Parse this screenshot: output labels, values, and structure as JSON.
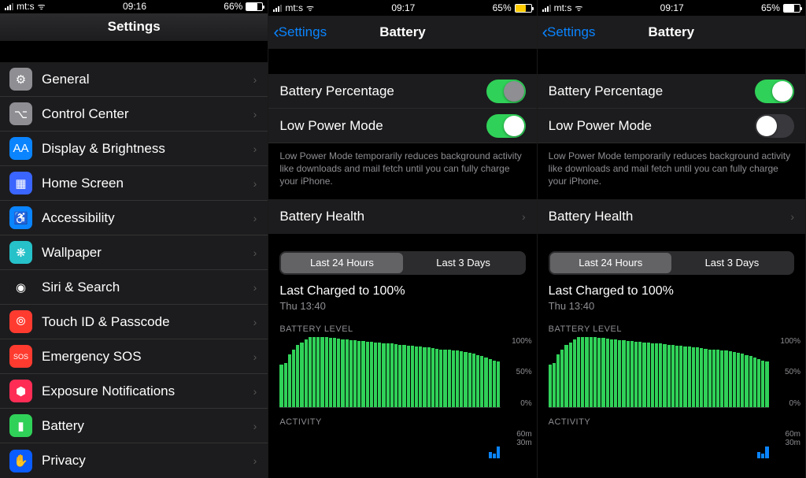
{
  "screens": [
    {
      "time": "09:16",
      "carrier": "mt:s",
      "battery_pct": "66%",
      "battery_fill": 66,
      "battery_color": "white",
      "title": "Settings",
      "has_back": false
    },
    {
      "time": "09:17",
      "carrier": "mt:s",
      "battery_pct": "65%",
      "battery_fill": 65,
      "battery_color": "yellow",
      "title": "Battery",
      "back_label": "Settings",
      "toggles": {
        "battery_percentage_on": true,
        "low_power_on": true,
        "dimmed_knob": true
      }
    },
    {
      "time": "09:17",
      "carrier": "mt:s",
      "battery_pct": "65%",
      "battery_fill": 65,
      "battery_color": "white",
      "title": "Battery",
      "back_label": "Settings",
      "toggles": {
        "battery_percentage_on": true,
        "low_power_on": false,
        "dimmed_knob": false
      }
    }
  ],
  "settings_items": [
    {
      "label": "General",
      "icon": "⚙",
      "bg": "#8e8e93"
    },
    {
      "label": "Control Center",
      "icon": "⌥",
      "bg": "#8e8e93"
    },
    {
      "label": "Display & Brightness",
      "icon": "AA",
      "bg": "#0a84ff"
    },
    {
      "label": "Home Screen",
      "icon": "▦",
      "bg": "#3a65ff"
    },
    {
      "label": "Accessibility",
      "icon": "♿",
      "bg": "#0a84ff"
    },
    {
      "label": "Wallpaper",
      "icon": "❋",
      "bg": "#26c1c9"
    },
    {
      "label": "Siri & Search",
      "icon": "◉",
      "bg": "#1c1c1e"
    },
    {
      "label": "Touch ID & Passcode",
      "icon": "⦾",
      "bg": "#ff3b30"
    },
    {
      "label": "Emergency SOS",
      "icon": "SOS",
      "bg": "#ff3b30"
    },
    {
      "label": "Exposure Notifications",
      "icon": "⬢",
      "bg": "#ff2d55"
    },
    {
      "label": "Battery",
      "icon": "▮",
      "bg": "#30d158"
    },
    {
      "label": "Privacy",
      "icon": "✋",
      "bg": "#0a5cff"
    }
  ],
  "battery_page": {
    "row_percentage": "Battery Percentage",
    "row_lowpower": "Low Power Mode",
    "lowpower_desc": "Low Power Mode temporarily reduces background activity like downloads and mail fetch until you can fully charge your iPhone.",
    "row_health": "Battery Health",
    "seg_24h": "Last 24 Hours",
    "seg_3d": "Last 3 Days",
    "charged_title": "Last Charged to 100%",
    "charged_sub": "Thu 13:40",
    "level_label": "BATTERY LEVEL",
    "activity_label": "ACTIVITY",
    "level_axis": [
      "100%",
      "50%",
      "0%"
    ],
    "activity_axis_top": "60m",
    "activity_axis_mid": "30m"
  },
  "chart_data": {
    "type": "bar",
    "title": "BATTERY LEVEL",
    "ylabel": "%",
    "ylim": [
      0,
      100
    ],
    "categories_note": "hourly bars over last ~24h (unlabeled x-ticks)",
    "values": [
      60,
      62,
      75,
      82,
      88,
      92,
      96,
      100,
      100,
      100,
      100,
      100,
      98,
      98,
      97,
      96,
      96,
      95,
      95,
      94,
      94,
      93,
      93,
      92,
      92,
      91,
      90,
      90,
      89,
      88,
      88,
      87,
      87,
      86,
      86,
      85,
      85,
      84,
      83,
      82,
      82,
      81,
      80,
      80,
      79,
      78,
      77,
      76,
      74,
      72,
      70,
      68,
      66,
      65
    ]
  },
  "activity_data": {
    "type": "bar",
    "title": "ACTIVITY",
    "ylabel": "minutes",
    "ylim_label_top": "60m",
    "values": [
      0,
      0,
      0,
      0,
      0,
      0,
      0,
      0,
      0,
      0,
      0,
      0,
      0,
      0,
      0,
      0,
      0,
      0,
      0,
      0,
      0,
      0,
      0,
      0,
      0,
      0,
      0,
      0,
      0,
      0,
      0,
      0,
      0,
      0,
      0,
      0,
      0,
      0,
      0,
      0,
      0,
      0,
      0,
      0,
      0,
      0,
      0,
      0,
      0,
      0,
      0,
      12,
      10,
      25
    ]
  }
}
